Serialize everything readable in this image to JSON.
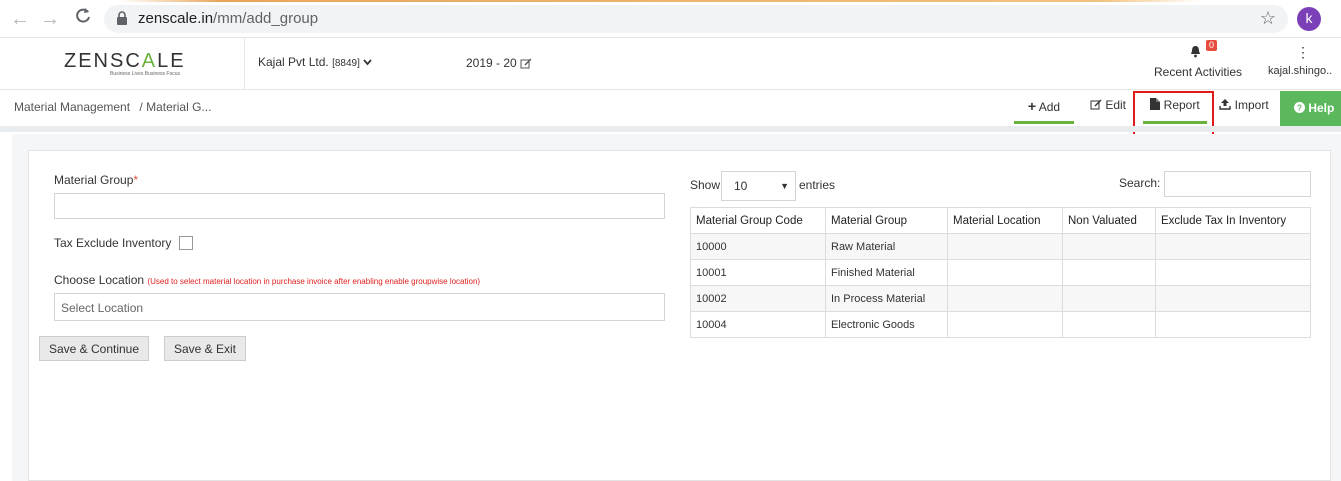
{
  "browser": {
    "url_host": "zenscale.in",
    "url_path": "/mm/add_group",
    "profile_initial": "k"
  },
  "header": {
    "logo_text_part1": "ZENSC",
    "logo_text_part2": "A",
    "logo_text_part3": "LE",
    "logo_tagline": "Business Lives Business Focus",
    "company": "Kajal Pvt Ltd.",
    "company_code": "[8849]",
    "fiscal_year": "2019 - 20",
    "notification_count": "0",
    "recent_activities": "Recent Activities",
    "user": "kajal.shingo.."
  },
  "breadcrumb": {
    "root": "Material Management",
    "current": "/ Material G..."
  },
  "toolbar": {
    "add": "Add",
    "edit": "Edit",
    "report": "Report",
    "import": "Import",
    "help": "Help"
  },
  "form": {
    "material_group_label": "Material Group",
    "required_mark": "*",
    "material_group_value": "",
    "tax_exclude_label": "Tax Exclude Inventory",
    "choose_location_label": "Choose Location",
    "choose_location_hint": "(Used to select material location in purchase invoice after enabling enable groupwise location)",
    "location_placeholder": "Select Location",
    "save_continue": "Save & Continue",
    "save_exit": "Save & Exit"
  },
  "table": {
    "show_label": "Show",
    "page_size": "10",
    "entries_label": "entries",
    "search_label": "Search:",
    "columns": [
      "Material Group Code",
      "Material Group",
      "Material Location",
      "Non Valuated",
      "Exclude Tax In Inventory"
    ],
    "rows": [
      [
        "10000",
        "Raw Material",
        "",
        "",
        ""
      ],
      [
        "10001",
        "Finished Material",
        "",
        "",
        ""
      ],
      [
        "10002",
        "In Process Material",
        "",
        "",
        ""
      ],
      [
        "10004",
        "Electronic Goods",
        "",
        "",
        ""
      ]
    ]
  },
  "colors": {
    "accent_green": "#6ab23e",
    "help_green": "#5cb85c",
    "highlight_red": "#e01b1b"
  }
}
